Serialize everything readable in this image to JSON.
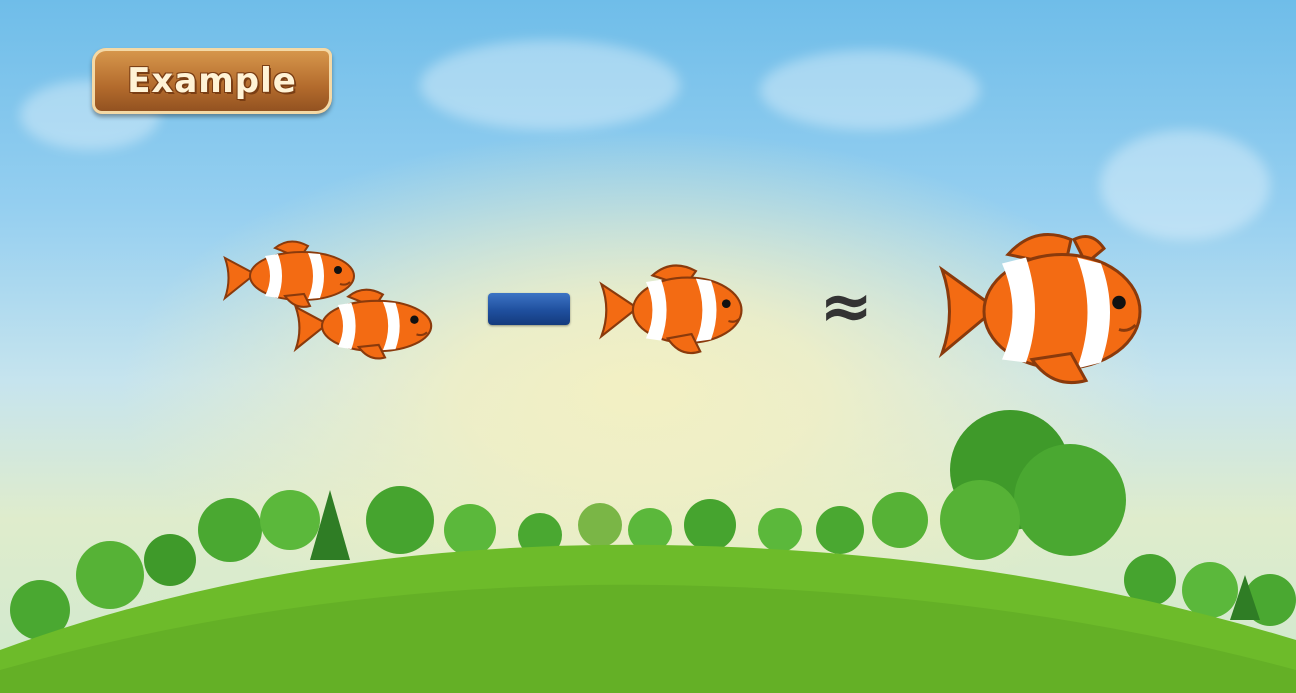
{
  "badge": {
    "label": "Example"
  },
  "equation": {
    "left_group_count": 2,
    "subtract_count": 1,
    "result_count": 1,
    "operators": {
      "minus": "",
      "approx": "≈"
    }
  },
  "colors": {
    "fish_orange": "#f36b13",
    "fish_stripe": "#ffffff",
    "fish_outline": "#8a3a0c",
    "minus_blue": "#1f4f9e",
    "approx_gray": "#333333",
    "hill_green": "#6dbb2a",
    "tree_green": "#3f9a2a"
  }
}
